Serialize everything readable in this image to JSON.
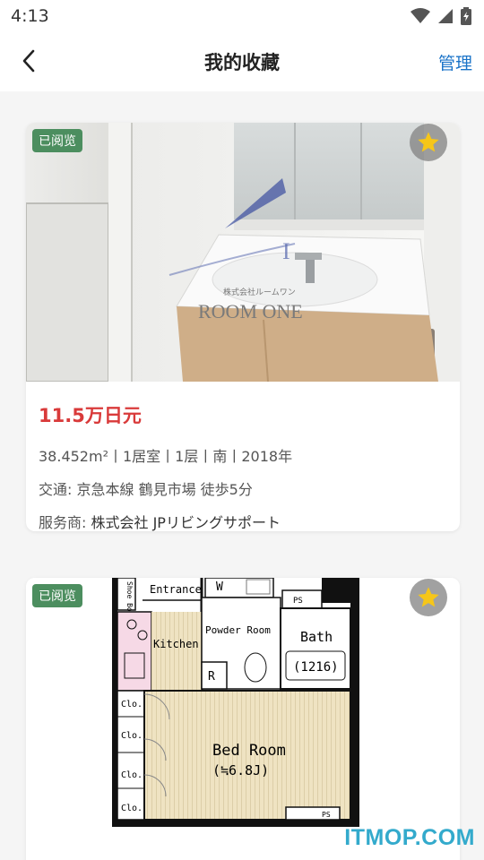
{
  "status_bar": {
    "time": "4:13",
    "icons": [
      "wifi-icon",
      "signal-icon",
      "battery-icon"
    ]
  },
  "header": {
    "title": "我的收藏",
    "manage_label": "管理"
  },
  "listings": [
    {
      "viewed_badge": "已阅览",
      "image_logo_text": "ROOM ONE",
      "image_logo_sub": "株式会社ルームワン",
      "price": "11.5万日元",
      "specs": "38.452m²丨1居室丨1层丨南丨2018年",
      "traffic_label": "交通:",
      "traffic_value": "京急本線 鶴見市場 徒歩5分",
      "agent_label": "服务商:",
      "agent_value": "株式会社 JPリビングサポート"
    },
    {
      "viewed_badge": "已阅览",
      "floorplan": {
        "shoe_box": "Shoe Box",
        "entrance": "Entrance",
        "w": "W",
        "ps_top": "PS",
        "kitchen": "Kitchen",
        "powder_room": "Powder Room",
        "bath": "Bath",
        "bath_size": "(1216)",
        "r": "R",
        "clo": [
          "Clo.",
          "Clo.",
          "Clo.",
          "Clo."
        ],
        "bed_room": "Bed Room",
        "bed_size": "(≒6.8J)",
        "ps_bottom": "PS"
      }
    }
  ],
  "watermark": "ITMOP.COM",
  "colors": {
    "accent": "#1a73c8",
    "price": "#d93a3a",
    "badge": "#4c8e5f",
    "star": "#f6c619"
  }
}
